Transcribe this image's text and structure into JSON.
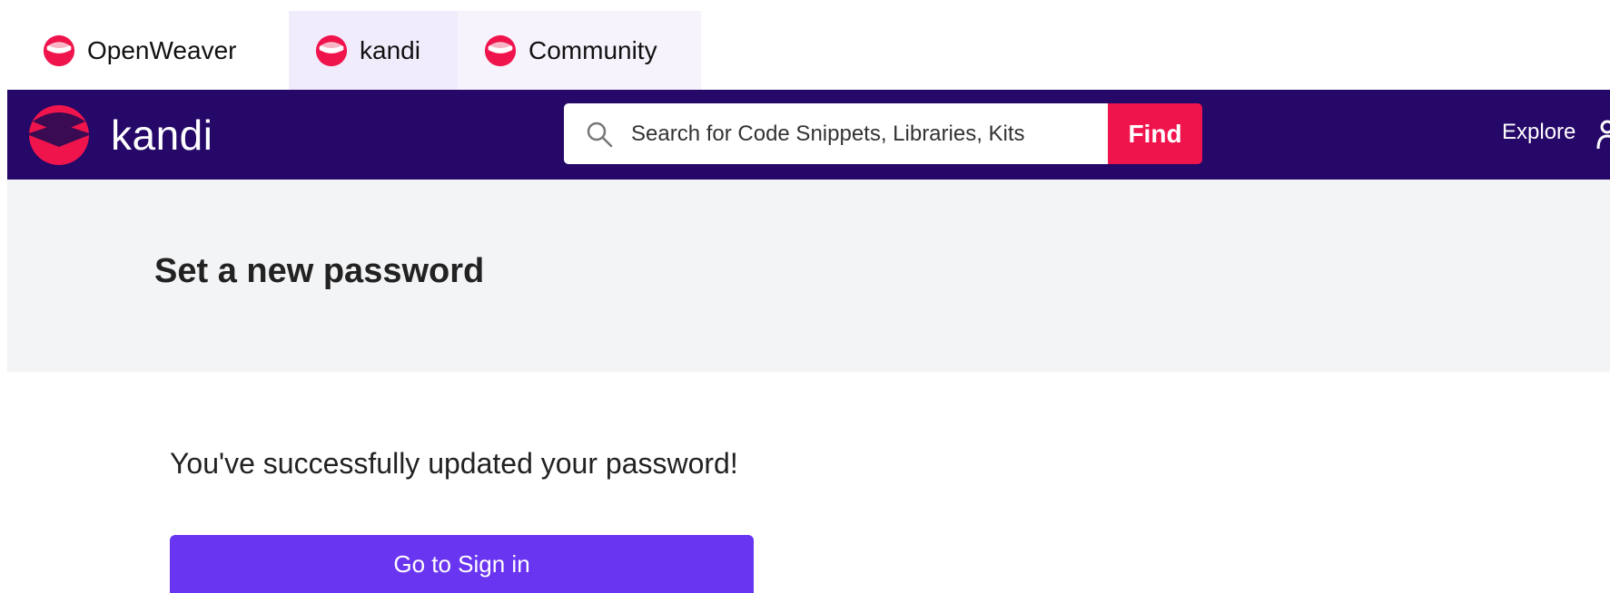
{
  "product_tabs": [
    {
      "label": "OpenWeaver"
    },
    {
      "label": "kandi"
    },
    {
      "label": "Community"
    }
  ],
  "header": {
    "logo_text": "kandi",
    "search_placeholder": "Search for Code Snippets, Libraries, Kits",
    "find_label": "Find",
    "explore_label": "Explore"
  },
  "page": {
    "title": "Set a new password",
    "success_message": "You've successfully updated your password!",
    "signin_label": "Go to Sign in"
  },
  "colors": {
    "header_bg": "#250868",
    "brand_red": "#f0144d",
    "primary_button": "#6a35f0",
    "title_band_bg": "#f3f4f6",
    "active_tab_bg": "#f1ecfb"
  }
}
